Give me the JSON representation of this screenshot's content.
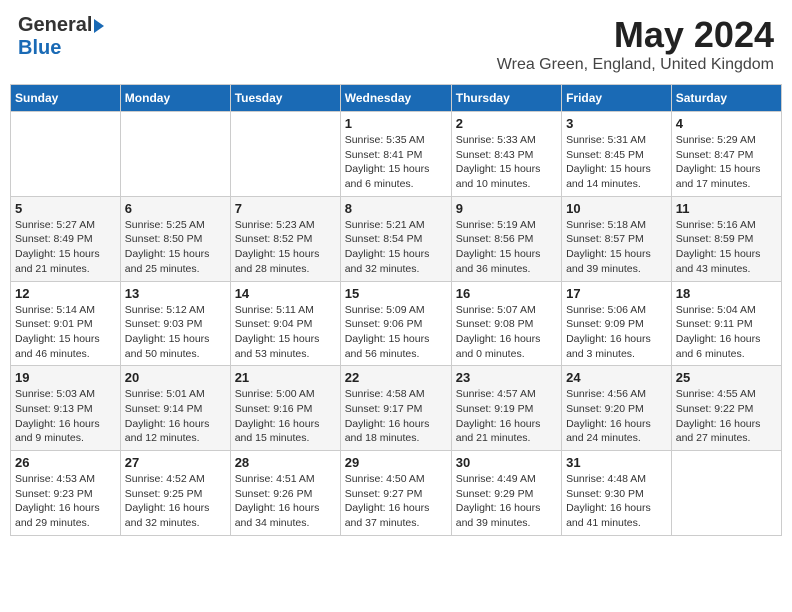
{
  "header": {
    "logo_general": "General",
    "logo_blue": "Blue",
    "month_title": "May 2024",
    "location": "Wrea Green, England, United Kingdom"
  },
  "weekdays": [
    "Sunday",
    "Monday",
    "Tuesday",
    "Wednesday",
    "Thursday",
    "Friday",
    "Saturday"
  ],
  "weeks": [
    [
      {
        "day": "",
        "sunrise": "",
        "sunset": "",
        "daylight": ""
      },
      {
        "day": "",
        "sunrise": "",
        "sunset": "",
        "daylight": ""
      },
      {
        "day": "",
        "sunrise": "",
        "sunset": "",
        "daylight": ""
      },
      {
        "day": "1",
        "sunrise": "Sunrise: 5:35 AM",
        "sunset": "Sunset: 8:41 PM",
        "daylight": "Daylight: 15 hours and 6 minutes."
      },
      {
        "day": "2",
        "sunrise": "Sunrise: 5:33 AM",
        "sunset": "Sunset: 8:43 PM",
        "daylight": "Daylight: 15 hours and 10 minutes."
      },
      {
        "day": "3",
        "sunrise": "Sunrise: 5:31 AM",
        "sunset": "Sunset: 8:45 PM",
        "daylight": "Daylight: 15 hours and 14 minutes."
      },
      {
        "day": "4",
        "sunrise": "Sunrise: 5:29 AM",
        "sunset": "Sunset: 8:47 PM",
        "daylight": "Daylight: 15 hours and 17 minutes."
      }
    ],
    [
      {
        "day": "5",
        "sunrise": "Sunrise: 5:27 AM",
        "sunset": "Sunset: 8:49 PM",
        "daylight": "Daylight: 15 hours and 21 minutes."
      },
      {
        "day": "6",
        "sunrise": "Sunrise: 5:25 AM",
        "sunset": "Sunset: 8:50 PM",
        "daylight": "Daylight: 15 hours and 25 minutes."
      },
      {
        "day": "7",
        "sunrise": "Sunrise: 5:23 AM",
        "sunset": "Sunset: 8:52 PM",
        "daylight": "Daylight: 15 hours and 28 minutes."
      },
      {
        "day": "8",
        "sunrise": "Sunrise: 5:21 AM",
        "sunset": "Sunset: 8:54 PM",
        "daylight": "Daylight: 15 hours and 32 minutes."
      },
      {
        "day": "9",
        "sunrise": "Sunrise: 5:19 AM",
        "sunset": "Sunset: 8:56 PM",
        "daylight": "Daylight: 15 hours and 36 minutes."
      },
      {
        "day": "10",
        "sunrise": "Sunrise: 5:18 AM",
        "sunset": "Sunset: 8:57 PM",
        "daylight": "Daylight: 15 hours and 39 minutes."
      },
      {
        "day": "11",
        "sunrise": "Sunrise: 5:16 AM",
        "sunset": "Sunset: 8:59 PM",
        "daylight": "Daylight: 15 hours and 43 minutes."
      }
    ],
    [
      {
        "day": "12",
        "sunrise": "Sunrise: 5:14 AM",
        "sunset": "Sunset: 9:01 PM",
        "daylight": "Daylight: 15 hours and 46 minutes."
      },
      {
        "day": "13",
        "sunrise": "Sunrise: 5:12 AM",
        "sunset": "Sunset: 9:03 PM",
        "daylight": "Daylight: 15 hours and 50 minutes."
      },
      {
        "day": "14",
        "sunrise": "Sunrise: 5:11 AM",
        "sunset": "Sunset: 9:04 PM",
        "daylight": "Daylight: 15 hours and 53 minutes."
      },
      {
        "day": "15",
        "sunrise": "Sunrise: 5:09 AM",
        "sunset": "Sunset: 9:06 PM",
        "daylight": "Daylight: 15 hours and 56 minutes."
      },
      {
        "day": "16",
        "sunrise": "Sunrise: 5:07 AM",
        "sunset": "Sunset: 9:08 PM",
        "daylight": "Daylight: 16 hours and 0 minutes."
      },
      {
        "day": "17",
        "sunrise": "Sunrise: 5:06 AM",
        "sunset": "Sunset: 9:09 PM",
        "daylight": "Daylight: 16 hours and 3 minutes."
      },
      {
        "day": "18",
        "sunrise": "Sunrise: 5:04 AM",
        "sunset": "Sunset: 9:11 PM",
        "daylight": "Daylight: 16 hours and 6 minutes."
      }
    ],
    [
      {
        "day": "19",
        "sunrise": "Sunrise: 5:03 AM",
        "sunset": "Sunset: 9:13 PM",
        "daylight": "Daylight: 16 hours and 9 minutes."
      },
      {
        "day": "20",
        "sunrise": "Sunrise: 5:01 AM",
        "sunset": "Sunset: 9:14 PM",
        "daylight": "Daylight: 16 hours and 12 minutes."
      },
      {
        "day": "21",
        "sunrise": "Sunrise: 5:00 AM",
        "sunset": "Sunset: 9:16 PM",
        "daylight": "Daylight: 16 hours and 15 minutes."
      },
      {
        "day": "22",
        "sunrise": "Sunrise: 4:58 AM",
        "sunset": "Sunset: 9:17 PM",
        "daylight": "Daylight: 16 hours and 18 minutes."
      },
      {
        "day": "23",
        "sunrise": "Sunrise: 4:57 AM",
        "sunset": "Sunset: 9:19 PM",
        "daylight": "Daylight: 16 hours and 21 minutes."
      },
      {
        "day": "24",
        "sunrise": "Sunrise: 4:56 AM",
        "sunset": "Sunset: 9:20 PM",
        "daylight": "Daylight: 16 hours and 24 minutes."
      },
      {
        "day": "25",
        "sunrise": "Sunrise: 4:55 AM",
        "sunset": "Sunset: 9:22 PM",
        "daylight": "Daylight: 16 hours and 27 minutes."
      }
    ],
    [
      {
        "day": "26",
        "sunrise": "Sunrise: 4:53 AM",
        "sunset": "Sunset: 9:23 PM",
        "daylight": "Daylight: 16 hours and 29 minutes."
      },
      {
        "day": "27",
        "sunrise": "Sunrise: 4:52 AM",
        "sunset": "Sunset: 9:25 PM",
        "daylight": "Daylight: 16 hours and 32 minutes."
      },
      {
        "day": "28",
        "sunrise": "Sunrise: 4:51 AM",
        "sunset": "Sunset: 9:26 PM",
        "daylight": "Daylight: 16 hours and 34 minutes."
      },
      {
        "day": "29",
        "sunrise": "Sunrise: 4:50 AM",
        "sunset": "Sunset: 9:27 PM",
        "daylight": "Daylight: 16 hours and 37 minutes."
      },
      {
        "day": "30",
        "sunrise": "Sunrise: 4:49 AM",
        "sunset": "Sunset: 9:29 PM",
        "daylight": "Daylight: 16 hours and 39 minutes."
      },
      {
        "day": "31",
        "sunrise": "Sunrise: 4:48 AM",
        "sunset": "Sunset: 9:30 PM",
        "daylight": "Daylight: 16 hours and 41 minutes."
      },
      {
        "day": "",
        "sunrise": "",
        "sunset": "",
        "daylight": ""
      }
    ]
  ]
}
